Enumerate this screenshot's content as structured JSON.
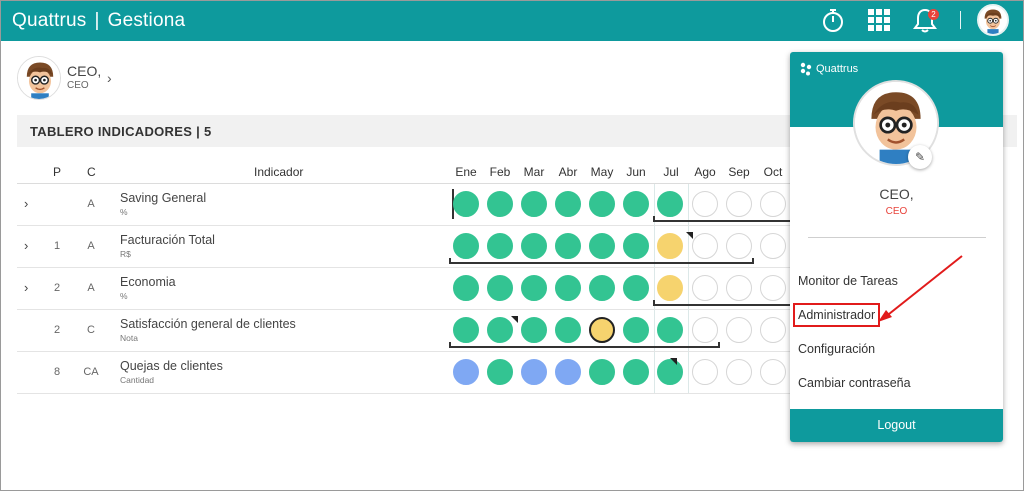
{
  "app": {
    "brand": "Quattrus",
    "product": "Gestiona",
    "separator": "|"
  },
  "topbar": {
    "notification_count": "2"
  },
  "profile": {
    "name": "CEO,",
    "role": "CEO"
  },
  "dashboard": {
    "title": "TABLERO INDICADORES | 5"
  },
  "table": {
    "headers": {
      "p": "P",
      "c": "C",
      "indicador": "Indicador"
    },
    "months": [
      "Ene",
      "Feb",
      "Mar",
      "Abr",
      "May",
      "Jun",
      "Jul",
      "Ago",
      "Sep",
      "Oct"
    ],
    "rows": [
      {
        "expandable": true,
        "p": "",
        "c": "A",
        "name": "Saving General",
        "unit": "%",
        "status": [
          "green",
          "green",
          "green",
          "green",
          "green",
          "green",
          "green",
          "empty",
          "empty",
          "empty"
        ]
      },
      {
        "expandable": true,
        "p": "1",
        "c": "A",
        "name": "Facturación Total",
        "unit": "R$",
        "status": [
          "green",
          "green",
          "green",
          "green",
          "green",
          "green",
          "yellow",
          "empty",
          "empty",
          "empty"
        ]
      },
      {
        "expandable": true,
        "p": "2",
        "c": "A",
        "name": "Economia",
        "unit": "%",
        "status": [
          "green",
          "green",
          "green",
          "green",
          "green",
          "green",
          "yellow",
          "empty",
          "empty",
          "empty"
        ]
      },
      {
        "expandable": false,
        "p": "2",
        "c": "C",
        "name": "Satisfacción general de clientes",
        "unit": "Nota",
        "status": [
          "green",
          "green",
          "green",
          "green",
          "yellow",
          "green",
          "green",
          "empty",
          "empty",
          "empty"
        ]
      },
      {
        "expandable": false,
        "p": "8",
        "c": "CA",
        "name": "Quejas de clientes",
        "unit": "Cantidad",
        "status": [
          "blue",
          "green",
          "blue",
          "blue",
          "green",
          "green",
          "green",
          "empty",
          "empty",
          "empty"
        ]
      }
    ]
  },
  "menu": {
    "logo": "Quattrus",
    "name": "CEO,",
    "role": "CEO",
    "items": [
      "Monitor de Tareas",
      "Administrador",
      "Configuración",
      "Cambiar contraseña"
    ],
    "highlighted_item": "Administrador",
    "logout": "Logout"
  },
  "colors": {
    "teal": "#0e9a9d",
    "green_status": "#33c492",
    "yellow_status": "#f6d36e",
    "blue_status": "#7fa8f3",
    "highlight_red": "#e11b1b"
  }
}
